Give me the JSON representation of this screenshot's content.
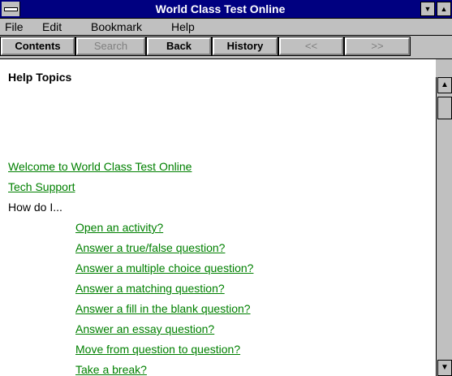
{
  "window": {
    "title": "World Class Test Online"
  },
  "menubar": {
    "items": [
      {
        "label": "File"
      },
      {
        "label": "Edit"
      },
      {
        "label": "Bookmark"
      },
      {
        "label": "Help"
      }
    ]
  },
  "buttonbar": {
    "buttons": [
      {
        "label": "Contents",
        "disabled": false
      },
      {
        "label": "Search",
        "disabled": true
      },
      {
        "label": "Back",
        "disabled": false
      },
      {
        "label": "History",
        "disabled": false
      },
      {
        "label": "<<",
        "disabled": true
      },
      {
        "label": ">>",
        "disabled": true
      }
    ]
  },
  "content": {
    "heading": "Help Topics",
    "links_top": [
      "Welcome to World Class Test Online",
      "Tech Support"
    ],
    "how_do_i": "How do I...",
    "links_indented": [
      "Open an activity?",
      "Answer a true/false question?",
      "Answer a multiple choice question?",
      "Answer a matching question?",
      "Answer a fill in the blank question?",
      "Answer an essay question?",
      "Move from question to question?",
      "Take a break?"
    ]
  },
  "icons": {
    "system_menu": "system-menu-icon",
    "minimize": "triangle-down-icon",
    "maximize": "triangle-up-icon",
    "scroll_up": "arrow-up-icon",
    "scroll_down": "arrow-down-icon"
  },
  "colors": {
    "titlebar": "#000080",
    "link": "#008000",
    "chrome": "#c0c0c0"
  }
}
